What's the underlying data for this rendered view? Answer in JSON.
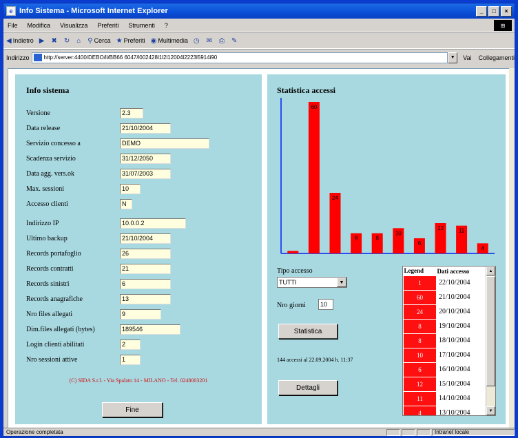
{
  "window": {
    "title": "Info Sistema - Microsoft Internet Explorer",
    "controls": {
      "minimize": "_",
      "maximize": "□",
      "close": "×"
    }
  },
  "menu": [
    "File",
    "Modifica",
    "Visualizza",
    "Preferiti",
    "Strumenti",
    "?"
  ],
  "toolbar": {
    "back": "Indietro",
    "search": "Cerca",
    "favorites": "Preferiti",
    "multimedia": "Multimedia"
  },
  "address": {
    "label": "Indirizzo",
    "url": "http://server:4400/DEBO/ll/BB66 6047/l002428l1l2l12004l2223l5914i90",
    "go": "Vai",
    "links": "Collegamenti"
  },
  "info": {
    "title": "Info sistema",
    "fields": [
      {
        "label": "Versione",
        "value": "2.3"
      },
      {
        "label": "Data release",
        "value": "21/10/2004"
      },
      {
        "label": "Servizio concesso a",
        "value": "DEMO"
      },
      {
        "label": "Scadenza servizio",
        "value": "31/12/2050"
      },
      {
        "label": "Data agg. vers.ok",
        "value": "31/07/2003"
      },
      {
        "label": "Max. sessioni",
        "value": "10"
      },
      {
        "label": "Accesso clienti",
        "value": "N"
      },
      {
        "label": "Indirizzo IP",
        "value": "10.0.0.2"
      },
      {
        "label": "Ultimo backup",
        "value": "21/10/2004"
      },
      {
        "label": "Records portafoglio",
        "value": "26"
      },
      {
        "label": "Records contratti",
        "value": "21"
      },
      {
        "label": "Records sinistri",
        "value": "6"
      },
      {
        "label": "Records anagrafiche",
        "value": "13"
      },
      {
        "label": "Nro files allegati",
        "value": "9"
      },
      {
        "label": "Dim.files allegati (bytes)",
        "value": "189546"
      },
      {
        "label": "Login clienti abilitati",
        "value": "2"
      },
      {
        "label": "Nro sessioni attive",
        "value": "1"
      }
    ],
    "footer": "(C) SIDA S.r.l. - Via Spalato 14 - MILANO - Tel. 0248003201",
    "close_button": "Fine"
  },
  "stats": {
    "title": "Statistica accessi",
    "type_label": "Tipo accesso",
    "type_value": "TUTTI",
    "days_label": "Nro giorni",
    "days_value": "10",
    "stats_button": "Statistica",
    "summary": "144 accessi al 22.09.2004 h. 11:37",
    "details_button": "Dettagli",
    "legend_header": [
      "Legend",
      "Dati accesso"
    ],
    "legend": [
      {
        "count": "1",
        "date": "22/10/2004"
      },
      {
        "count": "60",
        "date": "21/10/2004"
      },
      {
        "count": "24",
        "date": "20/10/2004"
      },
      {
        "count": "8",
        "date": "19/10/2004"
      },
      {
        "count": "8",
        "date": "18/10/2004"
      },
      {
        "count": "10",
        "date": "17/10/2004"
      },
      {
        "count": "6",
        "date": "16/10/2004"
      },
      {
        "count": "12",
        "date": "15/10/2004"
      },
      {
        "count": "11",
        "date": "14/10/2004"
      },
      {
        "count": "4",
        "date": "13/10/2004"
      }
    ]
  },
  "status": {
    "left": "Operazione completata",
    "zone": "Intranet locale"
  },
  "chart_data": {
    "type": "bar",
    "title": "Statistica accessi",
    "categories": [
      "22/10/2004",
      "21/10/2004",
      "20/10/2004",
      "19/10/2004",
      "18/10/2004",
      "17/10/2004",
      "16/10/2004",
      "15/10/2004",
      "14/10/2004",
      "13/10/2004"
    ],
    "values": [
      1,
      60,
      24,
      8,
      8,
      10,
      6,
      12,
      11,
      4
    ],
    "ylim": [
      0,
      60
    ],
    "color": "#ff0000"
  }
}
